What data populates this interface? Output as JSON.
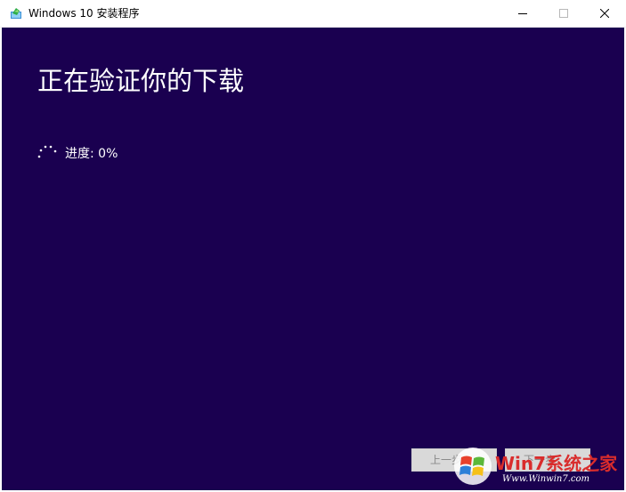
{
  "window": {
    "title": "Windows 10 安装程序",
    "icon": "setup-app-icon"
  },
  "main": {
    "heading": "正在验证你的下载",
    "progress_label": "进度: 0%",
    "progress_value": 0
  },
  "footer": {
    "back_label": "上一步",
    "next_label": "下一步"
  },
  "watermark": {
    "brand": "Win7系统之家",
    "url": "Www.Winwin7.com"
  },
  "colors": {
    "content_bg": "#1a0050",
    "text": "#ffffff",
    "disabled_button_bg": "#d9d9d9"
  }
}
